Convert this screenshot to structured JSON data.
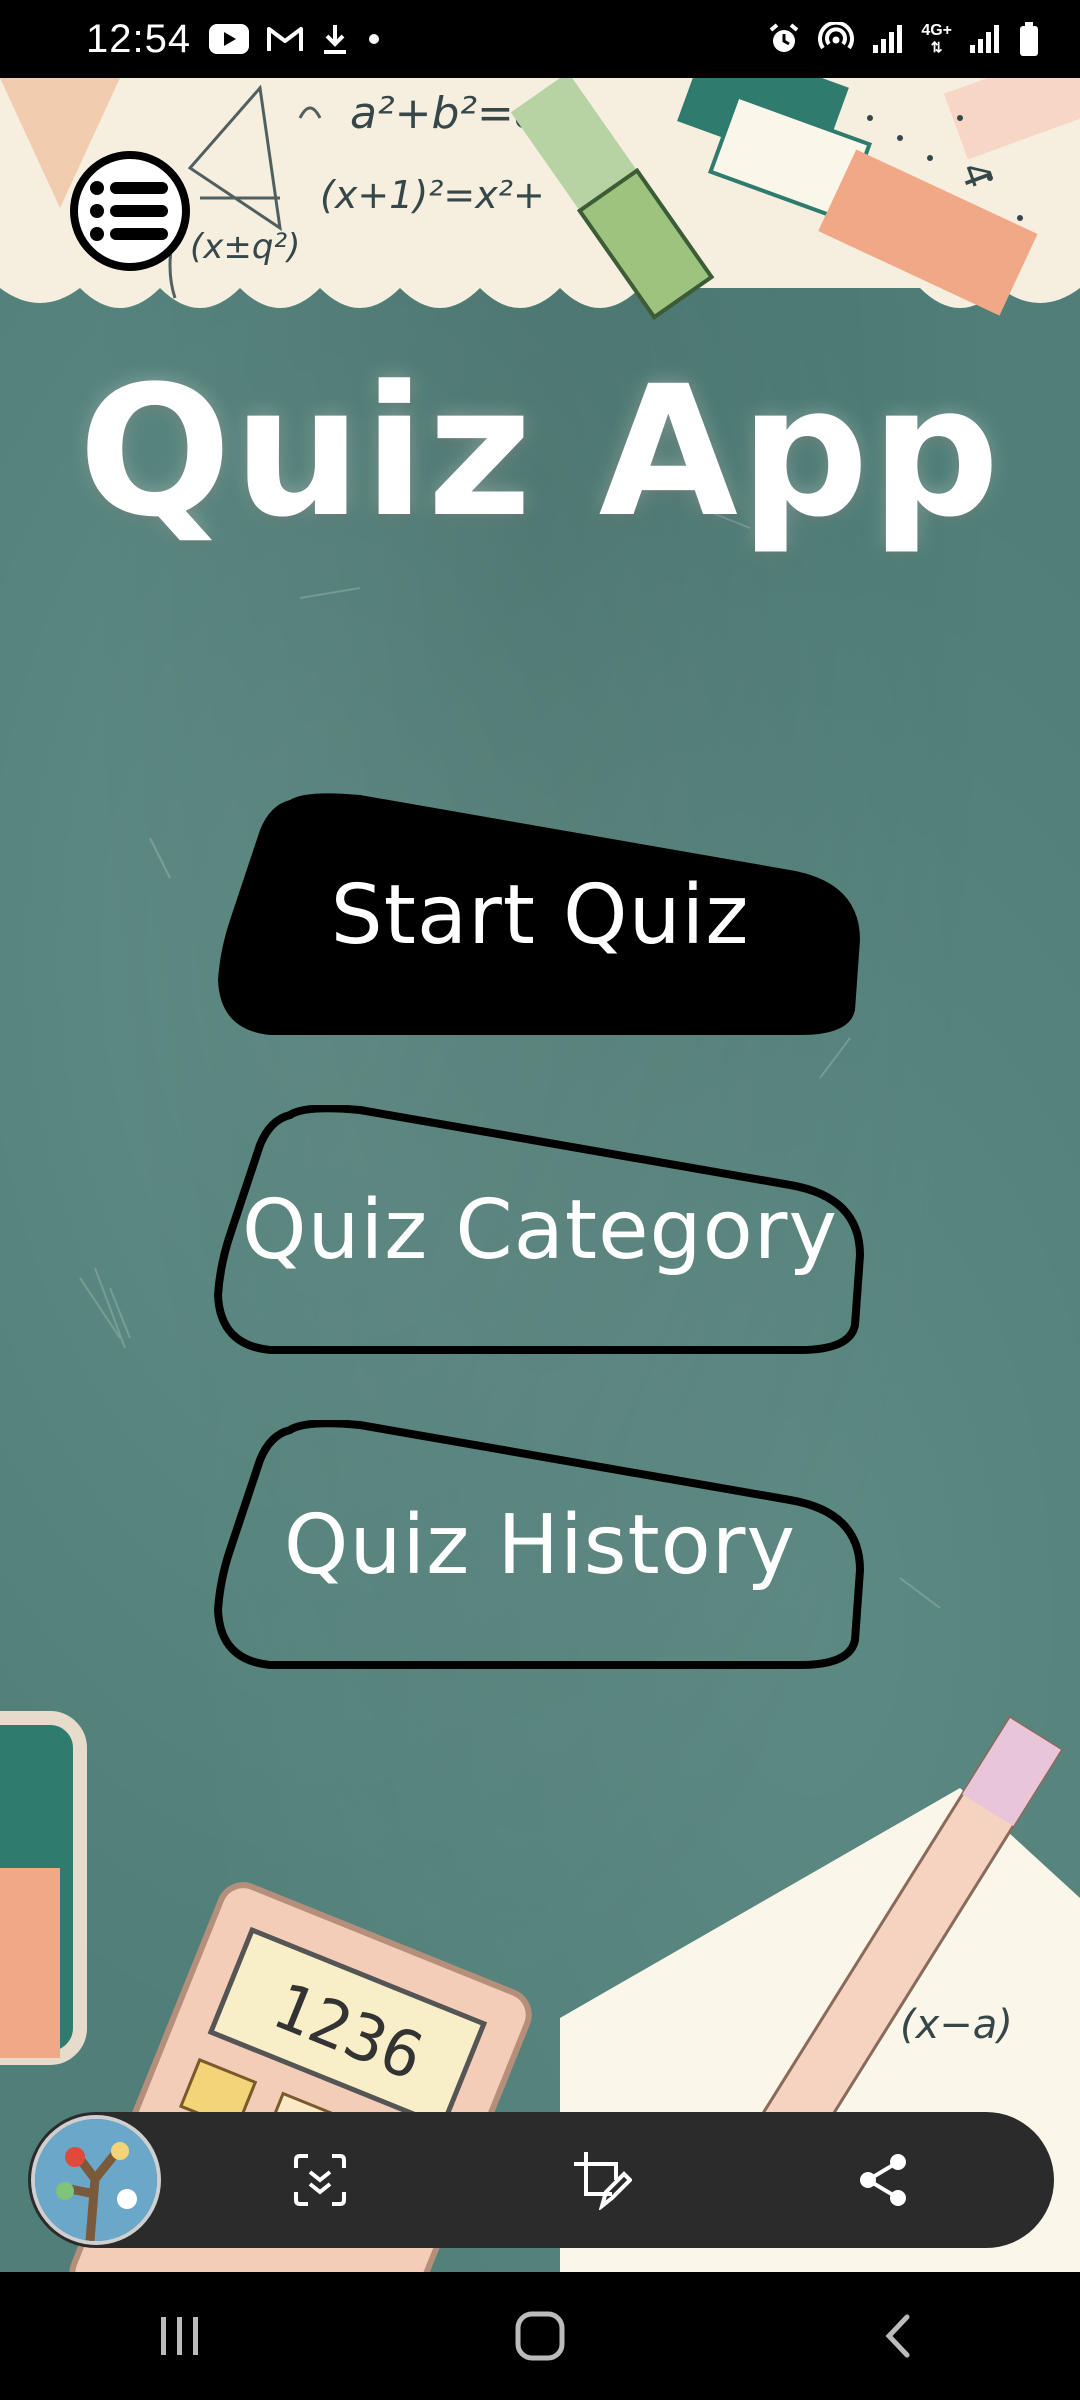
{
  "status_bar": {
    "time": "12:54",
    "left_icons": [
      "youtube-icon",
      "gmail-icon",
      "download-icon",
      "dot-icon"
    ],
    "right_icons": [
      "alarm-icon",
      "hotspot-icon",
      "signal-icon",
      "4g-icon",
      "signal-icon",
      "battery-icon"
    ],
    "network_label": "4G+"
  },
  "app": {
    "title": "Quiz App",
    "menu_icon": "list-menu-icon",
    "buttons": [
      {
        "label": "Start Quiz",
        "style": "filled"
      },
      {
        "label": "Quiz Category",
        "style": "outline"
      },
      {
        "label": "Quiz History",
        "style": "outline"
      }
    ]
  },
  "screenshot_toolbar": {
    "icons": [
      "thumbnail",
      "scroll-capture-icon",
      "edit-crop-icon",
      "share-icon"
    ]
  },
  "nav_bar": {
    "icons": [
      "recents-icon",
      "home-icon",
      "back-icon"
    ]
  },
  "colors": {
    "chalkboard": "#4f7f78",
    "button_fill": "#000000",
    "text": "#ffffff",
    "toolbar": "#2b2b2b"
  }
}
